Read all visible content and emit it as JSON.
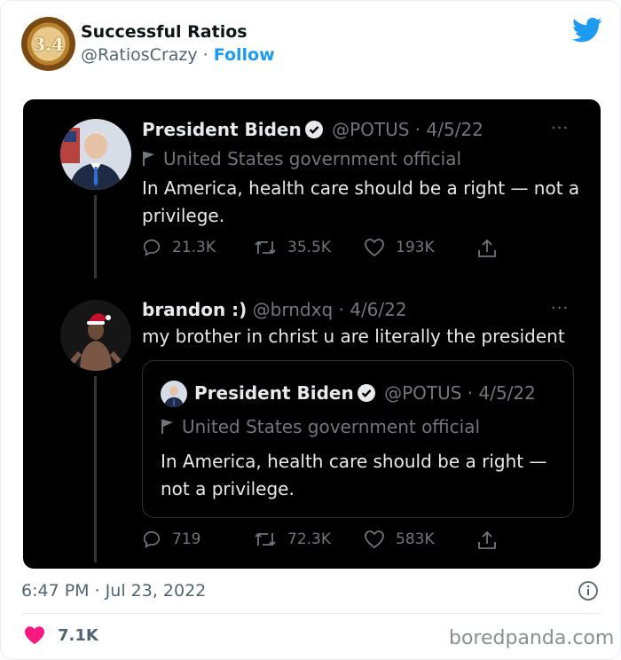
{
  "header": {
    "avatar_text": "3.4",
    "name": "Successful Ratios",
    "handle": "@RatiosCrazy",
    "separator": " · ",
    "follow": "Follow",
    "brand_icon": "twitter-bird-icon"
  },
  "tweet1": {
    "name": "President Biden",
    "handle_date": "@POTUS · 4/5/22",
    "label": "United States government official",
    "text": "In America, health care should be a right — not a privilege.",
    "more": "···",
    "replies": "21.3K",
    "retweets": "35.5K",
    "likes": "193K"
  },
  "tweet2": {
    "name": "brandon :)",
    "handle_date": "@brndxq · 4/6/22",
    "text": "my brother in christ u are literally the president",
    "more": "···",
    "replies": "719",
    "retweets": "72.3K",
    "likes": "583K"
  },
  "quoted": {
    "name": "President Biden",
    "handle_date": "@POTUS · 4/5/22",
    "label": "United States government official",
    "text": "In America, health care should be a right — not a privilege."
  },
  "footer": {
    "timestamp": "6:47 PM · Jul 23, 2022",
    "likes": "7.1K"
  },
  "watermark": "boredpanda.com",
  "colors": {
    "accent": "#1d9bf0",
    "like_heart": "#f91880",
    "dark_bg": "#000000",
    "dark_text": "#e7e9ea",
    "dark_muted": "#71767b"
  }
}
